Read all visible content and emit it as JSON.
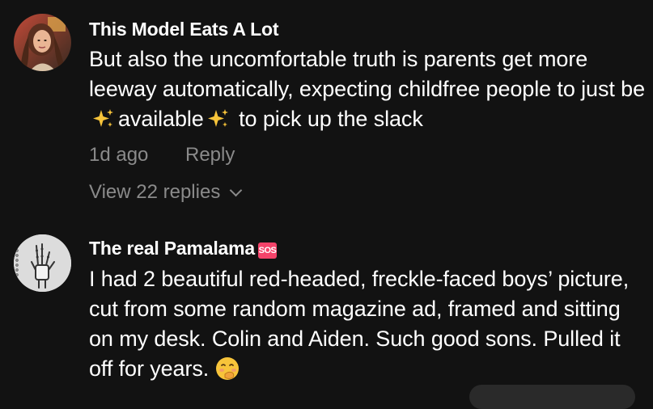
{
  "comments": [
    {
      "username": "This Model Eats A Lot",
      "text_before": "But also the uncomfortable truth is parents get more leeway automatically, expecting childfree people to just be",
      "text_middle": "available",
      "text_after": "to pick up the slack",
      "time": "1d ago",
      "reply_label": "Reply",
      "view_replies": "View 22 replies",
      "avatar_icon": "profile-photo-icon"
    },
    {
      "username": "The real Pamalama",
      "badge": "SOS",
      "text": "I had 2 beautiful red-headed, freckle-faced boys’ picture, cut from some random magazine ad, framed and sitting on my desk. Colin and Aiden. Such good sons. Pulled it off for years.",
      "avatar_icon": "skeleton-hand-icon",
      "emoji": "face-with-hand-over-mouth-icon"
    }
  ],
  "colors": {
    "background": "#121212",
    "text_primary": "#ffffff",
    "text_secondary": "#8a8a8a",
    "badge": "#f5436a",
    "sparkle": "#f7c43a"
  }
}
